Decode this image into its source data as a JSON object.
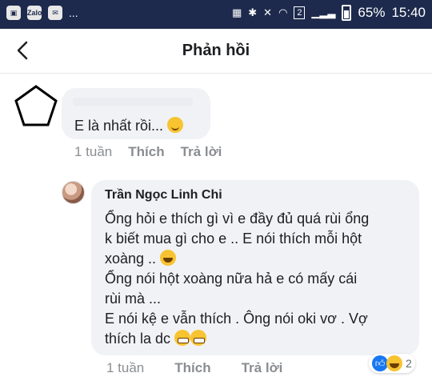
{
  "status_bar": {
    "left_icons": [
      "notification-icon",
      "zalo-icon",
      "message-icon"
    ],
    "zalo_label": "Zalo",
    "dots": "...",
    "sim_badge": "2",
    "battery": "65%",
    "time": "15:40"
  },
  "header": {
    "title": "Phản hồi",
    "back_icon": "back-arrow-icon"
  },
  "comments": [
    {
      "author": "",
      "text": "E là nhất rồi...",
      "emoji": "smiling-face-icon",
      "time": "1 tuần",
      "like_label": "Thích",
      "reply_label": "Trả lời"
    },
    {
      "author": "Trần Ngọc Linh Chi",
      "lines": [
        "Ổng hỏi e thích gì vì e đầy đủ quá rùi ổng",
        "k biết mua gì cho e ..  E nói thích mỗi hột",
        "xoàng .. ",
        "Ổng nói hột xoàng nữa hả e có mấy cái",
        "rùi mà ...",
        "E nói kệ e vẫn thích . Ông nói oki vơ . Vợ",
        "thích la dc "
      ],
      "time": "1 tuần",
      "like_label": "Thích",
      "reply_label": "Trả lời",
      "reaction_count": "2"
    }
  ]
}
